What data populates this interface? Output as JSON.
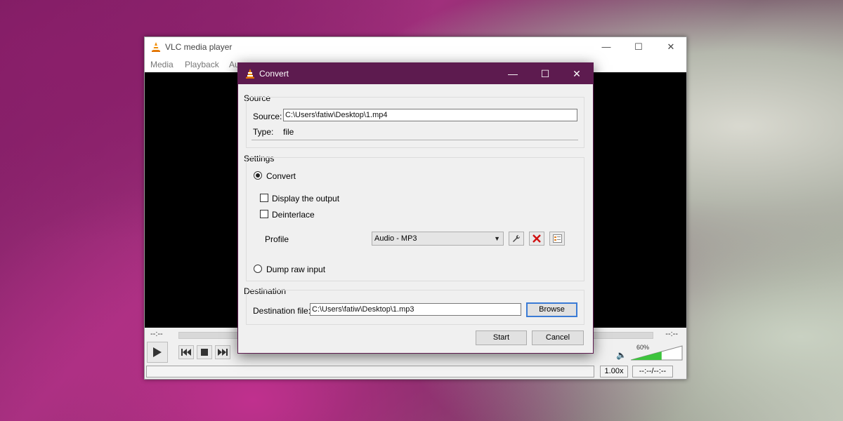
{
  "vlc": {
    "title": "VLC media player",
    "menu": [
      "Media",
      "Playback",
      "Au"
    ],
    "time_elapsed": "--:--",
    "time_total": "--:--",
    "volume": "60%",
    "volume_level": 0.6,
    "speed": "1.00x",
    "time_display": "--:--/--:--"
  },
  "dialog": {
    "title": "Convert",
    "source": {
      "group": "Source",
      "source_label": "Source:",
      "source_value": "C:\\Users\\fatiw\\Desktop\\1.mp4",
      "type_label": "Type:",
      "type_value": "file"
    },
    "settings": {
      "group": "Settings",
      "convert_label": "Convert",
      "display_output_label": "Display the output",
      "deinterlace_label": "Deinterlace",
      "profile_label": "Profile",
      "profile_value": "Audio - MP3",
      "dump_raw_label": "Dump raw input"
    },
    "destination": {
      "group": "Destination",
      "file_label": "Destination file:",
      "file_value": "C:\\Users\\fatiw\\Desktop\\1.mp3",
      "browse_label": "Browse"
    },
    "start_label": "Start",
    "cancel_label": "Cancel"
  },
  "icons": {
    "vlc_cone": "vlc-cone-icon",
    "minimize": "minimize-icon",
    "maximize": "maximize-icon",
    "close": "close-icon"
  },
  "colors": {
    "dialog_titlebar": "#5d1b4f",
    "video_bg": "#000000",
    "focus_border": "#3a7bd5",
    "volume_green": "#3cc43c",
    "delete_red": "#d01010"
  }
}
